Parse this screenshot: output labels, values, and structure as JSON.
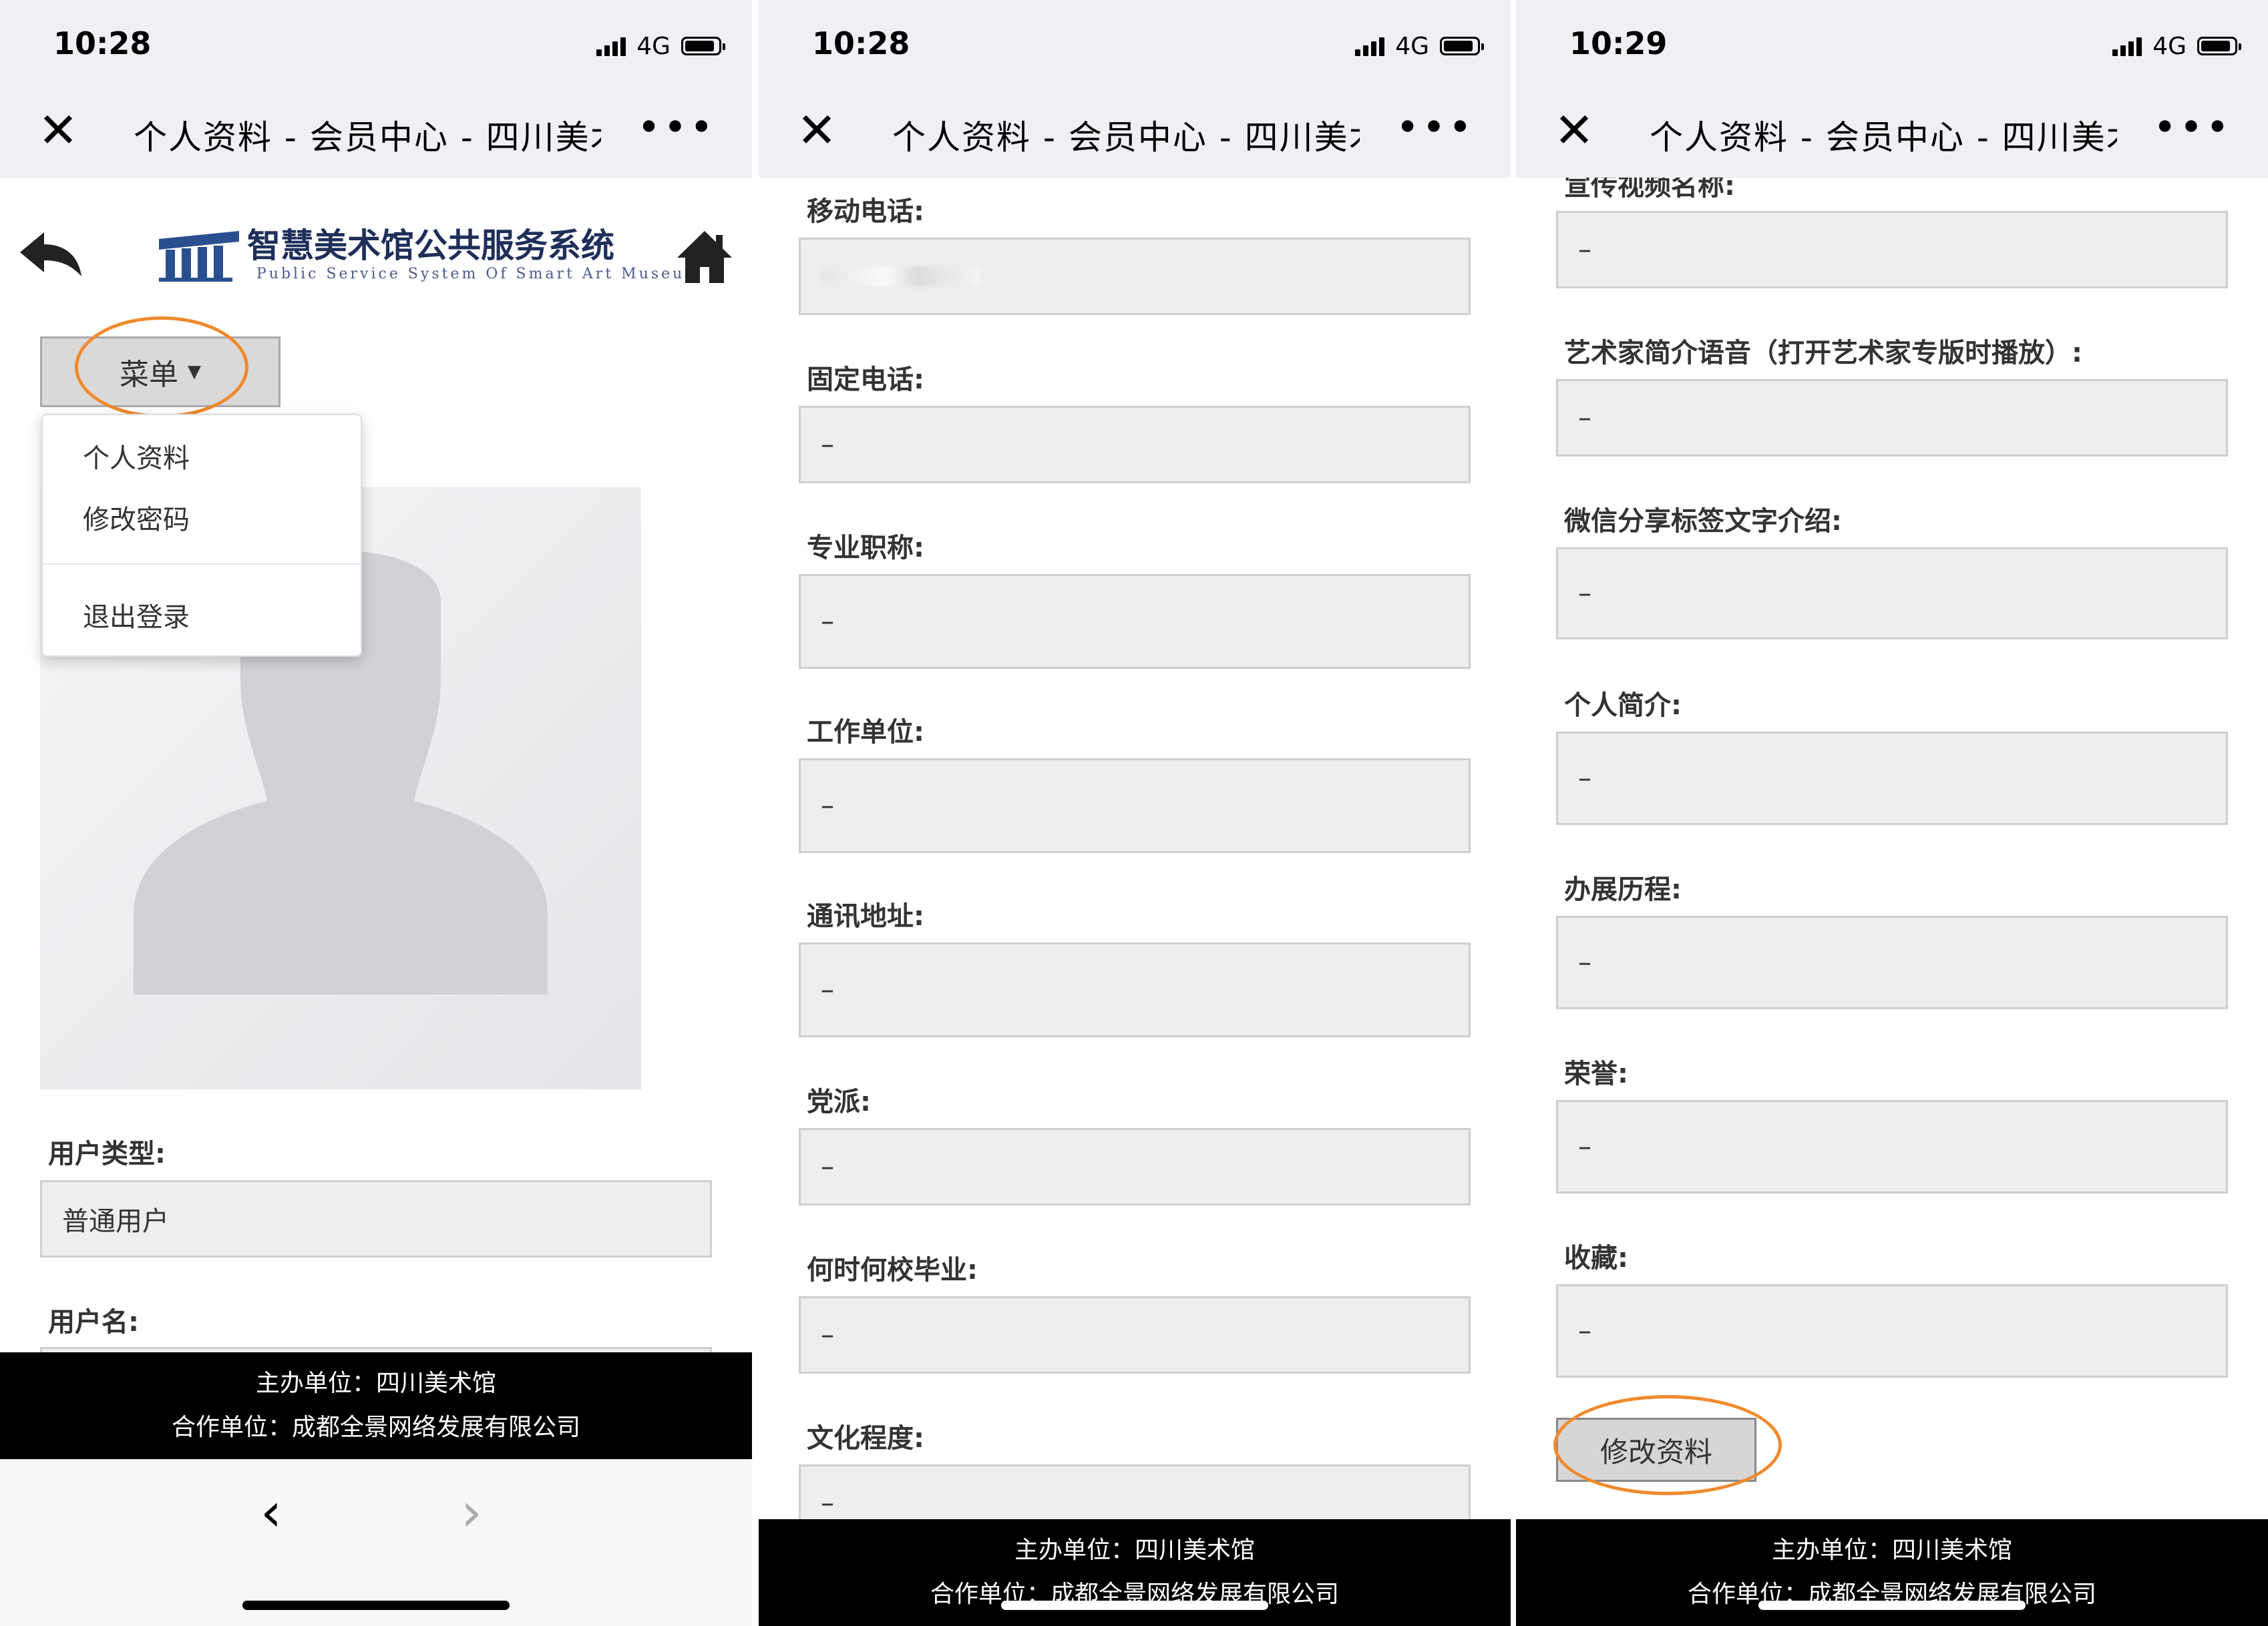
{
  "status": {
    "time1": "10:28",
    "time2": "10:28",
    "time3": "10:29",
    "network": "4G"
  },
  "nav": {
    "title": "个人资料 - 会员中心 - 四川美术馆",
    "close_icon": "close-icon",
    "more_icon": "more-icon"
  },
  "header": {
    "logo_title": "智慧美术馆公共服务系统",
    "logo_subtitle": "Public Service System Of Smart Art Museum"
  },
  "menu": {
    "button_label": "菜单",
    "items": [
      "个人资料",
      "修改密码",
      "退出登录"
    ]
  },
  "panel1": {
    "fields": [
      {
        "label": "用户类型:",
        "value": "普通用户"
      },
      {
        "label": "用户名:",
        "value": ""
      }
    ]
  },
  "panel2": {
    "fields": [
      {
        "label": "移动电话:",
        "value": ""
      },
      {
        "label": "固定电话:",
        "value": "–"
      },
      {
        "label": "专业职称:",
        "value": "–"
      },
      {
        "label": "工作单位:",
        "value": "–"
      },
      {
        "label": "通讯地址:",
        "value": "–"
      },
      {
        "label": "党派:",
        "value": "–"
      },
      {
        "label": "何时何校毕业:",
        "value": "–"
      },
      {
        "label": "文化程度:",
        "value": "–"
      }
    ]
  },
  "panel3": {
    "fields": [
      {
        "label": "宣传视频名称:",
        "value": "–"
      },
      {
        "label": "艺术家简介语音（打开艺术家专版时播放）:",
        "value": "–"
      },
      {
        "label": "微信分享标签文字介绍:",
        "value": "–"
      },
      {
        "label": "个人简介:",
        "value": "–"
      },
      {
        "label": "办展历程:",
        "value": "–"
      },
      {
        "label": "荣誉:",
        "value": "–"
      },
      {
        "label": "收藏:",
        "value": "–"
      }
    ],
    "submit_label": "修改资料"
  },
  "footer": {
    "sponsor": "主办单位：四川美术馆",
    "partner": "合作单位：成都全景网络发展有限公司"
  },
  "colors": {
    "annotation": "#f08a2c",
    "footer_bg": "#000000",
    "field_bg": "#eeeeee",
    "title_navy": "#1f2f5a"
  }
}
